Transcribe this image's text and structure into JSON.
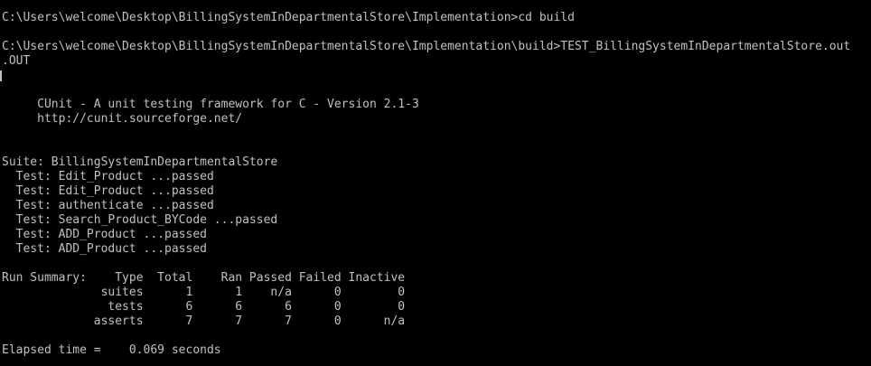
{
  "terminal": {
    "lines": [
      "C:\\Users\\welcome\\Desktop\\BillingSystemInDepartmentalStore\\Implementation>cd build",
      "C:\\Users\\welcome\\Desktop\\BillingSystemInDepartmentalStore\\Implementation\\build>TEST_BillingSystemInDepartmentalStore.out",
      ".OUT",
      "     CUnit - A unit testing framework for C - Version 2.1-3",
      "     http://cunit.sourceforge.net/",
      "Suite: BillingSystemInDepartmentalStore",
      "  Test: Edit_Product ...passed",
      "  Test: Edit_Product ...passed",
      "  Test: authenticate ...passed",
      "  Test: Search_Product_BYCode ...passed",
      "  Test: ADD_Product ...passed",
      "  Test: ADD_Product ...passed",
      "Run Summary:    Type  Total    Ran Passed Failed Inactive",
      "              suites      1      1    n/a      0        0",
      "               tests      6      6      6      0        0",
      "             asserts      7      7      7      0      n/a",
      "Elapsed time =    0.069 seconds"
    ]
  },
  "colors": {
    "background": "#000000",
    "text": "#c0c0c0"
  }
}
